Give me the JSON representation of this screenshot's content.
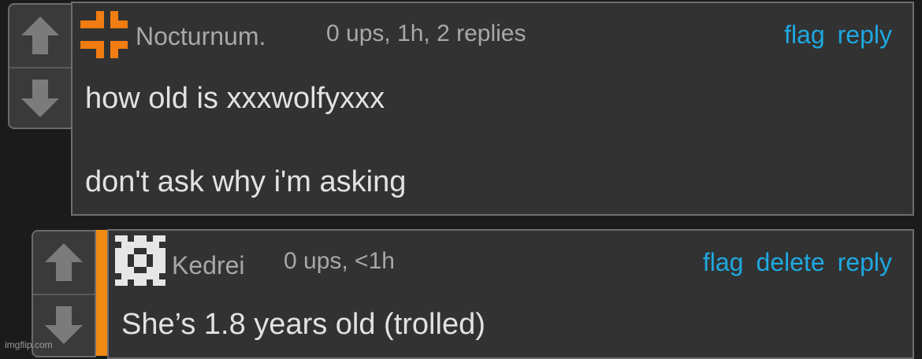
{
  "comments": [
    {
      "username": "Nocturnum.",
      "meta": "0 ups, 1h, 2 replies",
      "actions": [
        "flag",
        "reply"
      ],
      "lines": [
        "how old is xxxwolfyxxx",
        "don't ask why i'm asking"
      ],
      "avatar_color": "#f07c12",
      "avatar": "orange-cross-icon"
    },
    {
      "username": "Kedrei",
      "meta": "0 ups, <1h",
      "actions": [
        "flag",
        "delete",
        "reply"
      ],
      "lines": [
        "She’s 1.8 years old (trolled)"
      ],
      "avatar_color": "#e6e6e6",
      "avatar": "pixel-pattern-icon",
      "reply_accent": "#f08a12"
    }
  ],
  "colors": {
    "link": "#1fa8e0",
    "text": "#e2e2e2",
    "muted": "#a8a8a8",
    "background": "#1b1b1b"
  },
  "watermark": "imgflip.com"
}
